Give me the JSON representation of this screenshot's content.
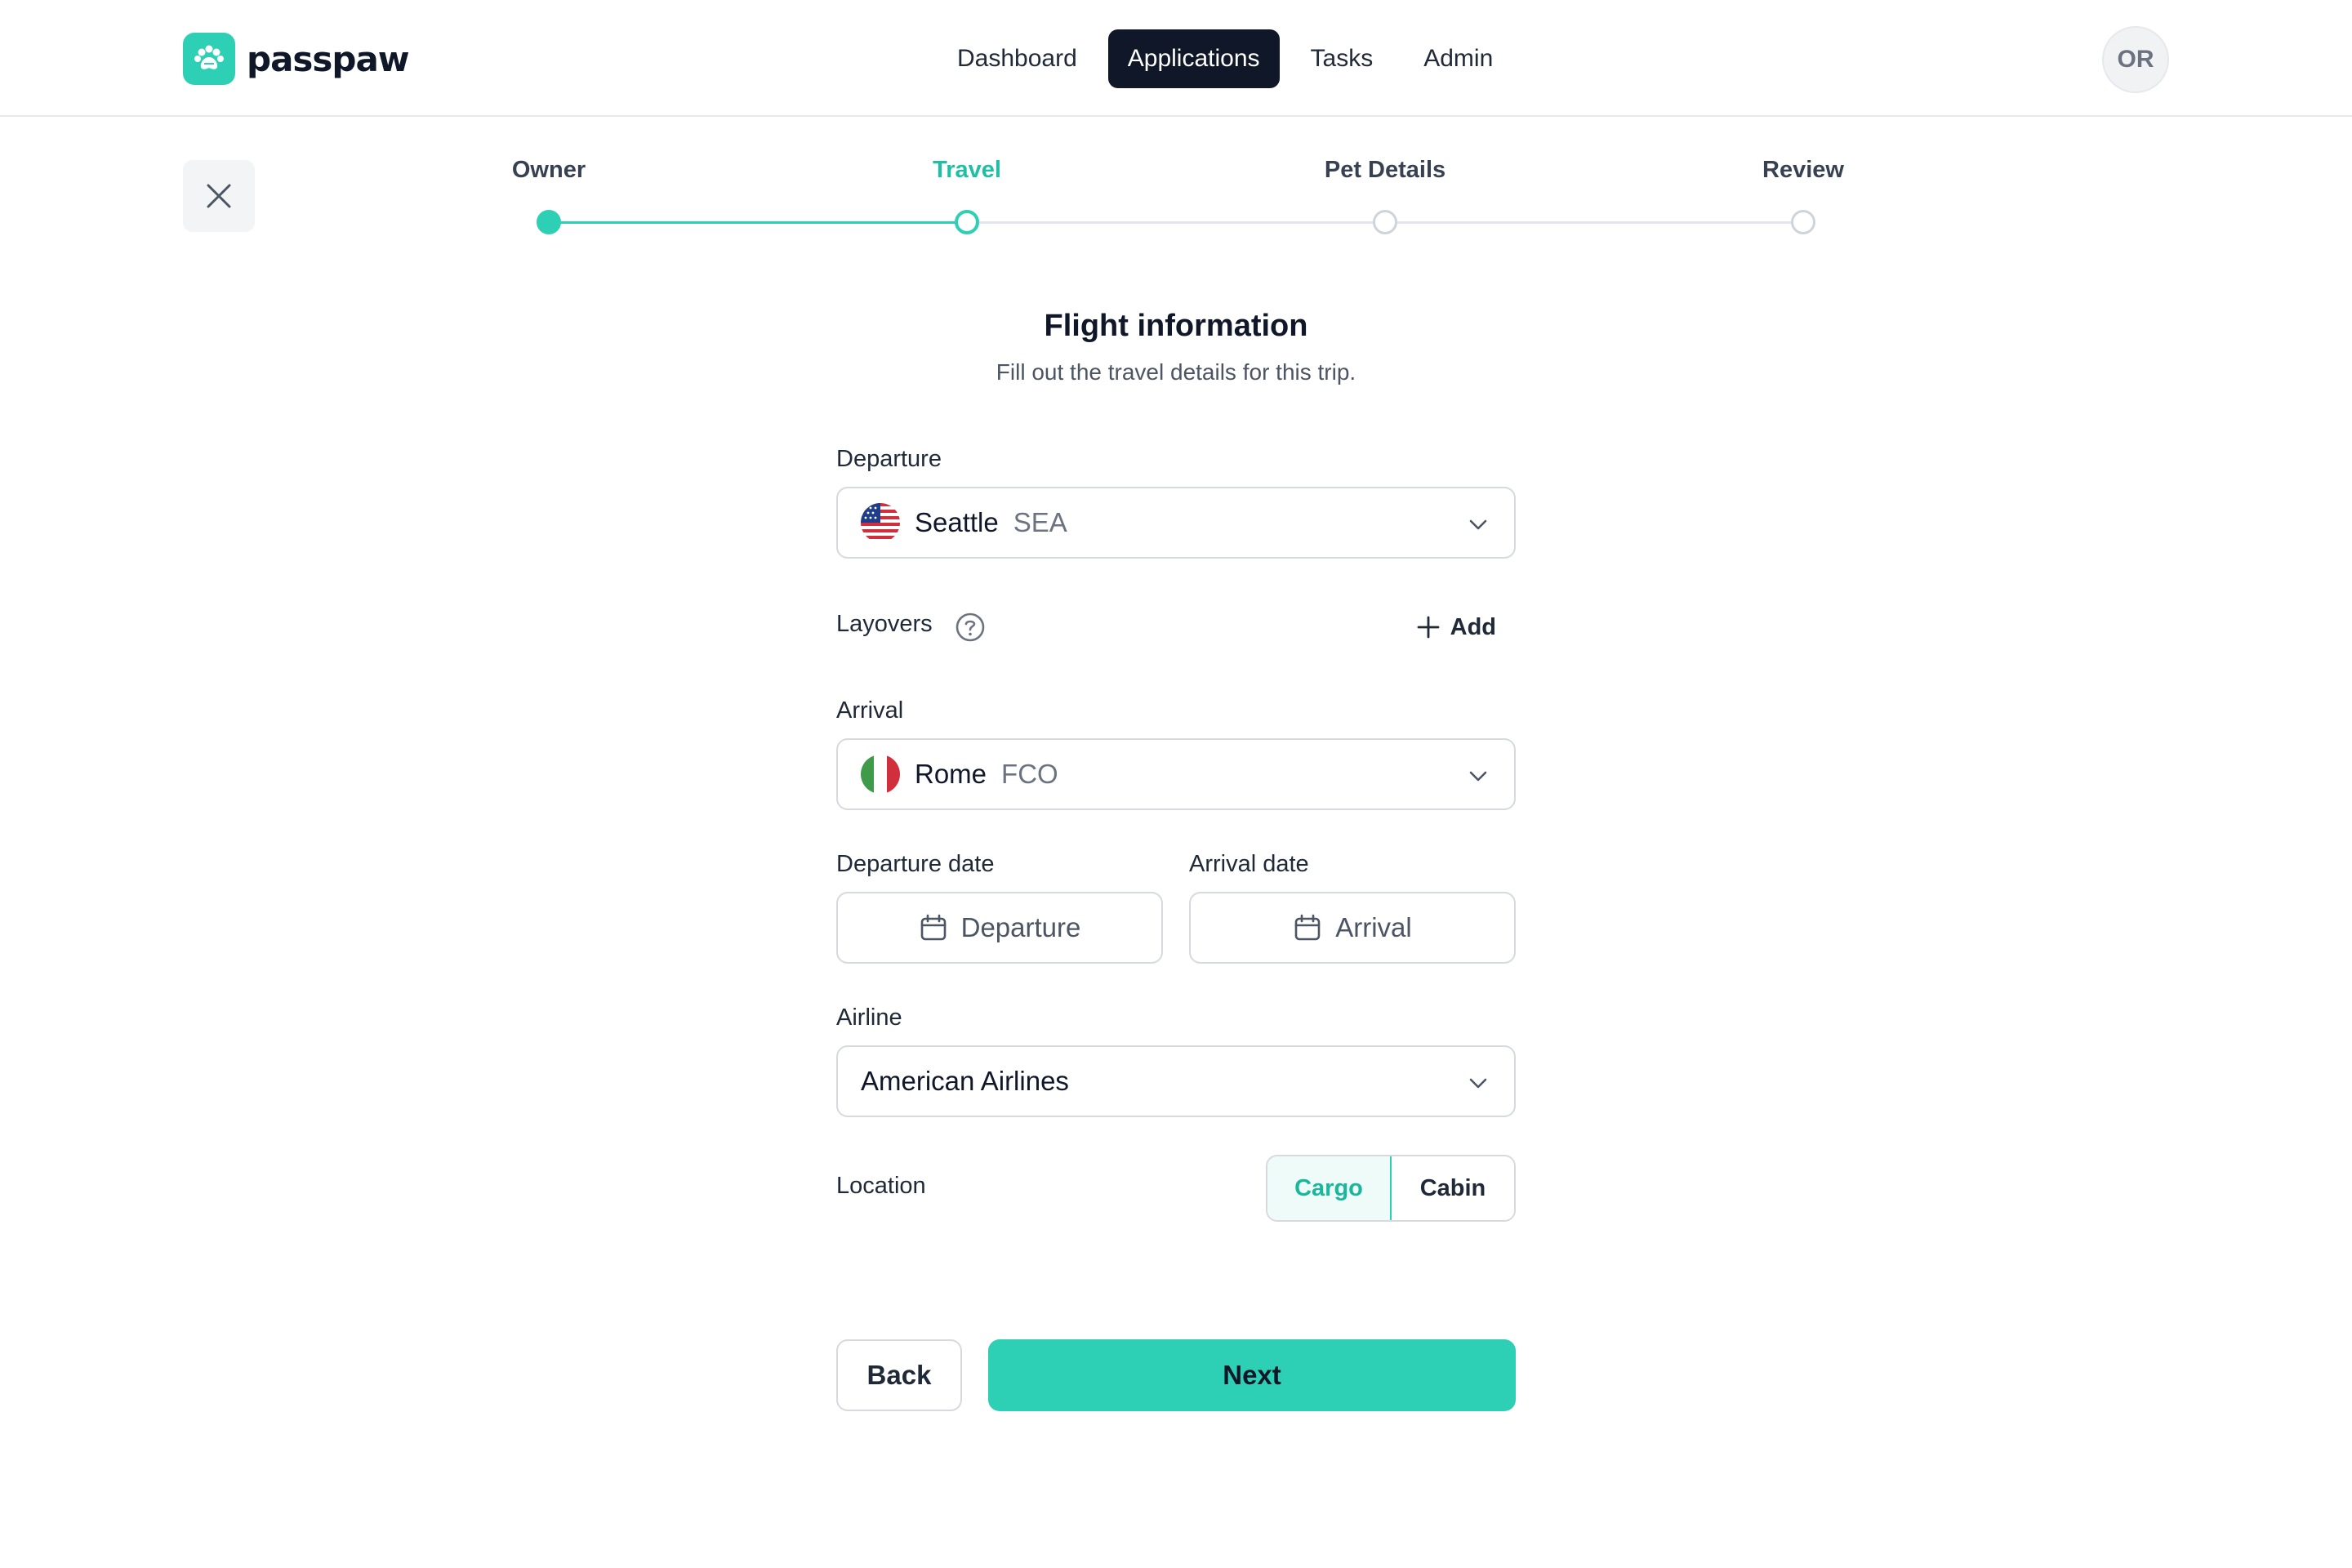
{
  "brand": {
    "name": "passpaw",
    "logo_icon": "paw-icon",
    "accent": "#2dd0b5"
  },
  "nav": {
    "items": [
      {
        "label": "Dashboard",
        "active": false
      },
      {
        "label": "Applications",
        "active": true
      },
      {
        "label": "Tasks",
        "active": false
      },
      {
        "label": "Admin",
        "active": false
      }
    ]
  },
  "user": {
    "initials": "OR"
  },
  "close": {
    "icon": "close-icon"
  },
  "stepper": {
    "steps": [
      {
        "label": "Owner",
        "state": "done"
      },
      {
        "label": "Travel",
        "state": "current"
      },
      {
        "label": "Pet Details",
        "state": "upcoming"
      },
      {
        "label": "Review",
        "state": "upcoming"
      }
    ]
  },
  "form": {
    "title": "Flight information",
    "subtitle": "Fill out the travel details for this trip.",
    "departure": {
      "label": "Departure",
      "city": "Seattle",
      "code": "SEA",
      "flag": "us-flag-icon"
    },
    "layovers": {
      "label": "Layovers",
      "help_icon": "question-circle-icon",
      "add_label": "Add"
    },
    "arrival": {
      "label": "Arrival",
      "city": "Rome",
      "code": "FCO",
      "flag": "italy-flag-icon"
    },
    "departure_date": {
      "label": "Departure date",
      "placeholder": "Departure"
    },
    "arrival_date": {
      "label": "Arrival date",
      "placeholder": "Arrival"
    },
    "airline": {
      "label": "Airline",
      "value": "American Airlines"
    },
    "location": {
      "label": "Location",
      "options": [
        "Cargo",
        "Cabin"
      ],
      "selected": "Cargo"
    },
    "back_label": "Back",
    "next_label": "Next"
  }
}
